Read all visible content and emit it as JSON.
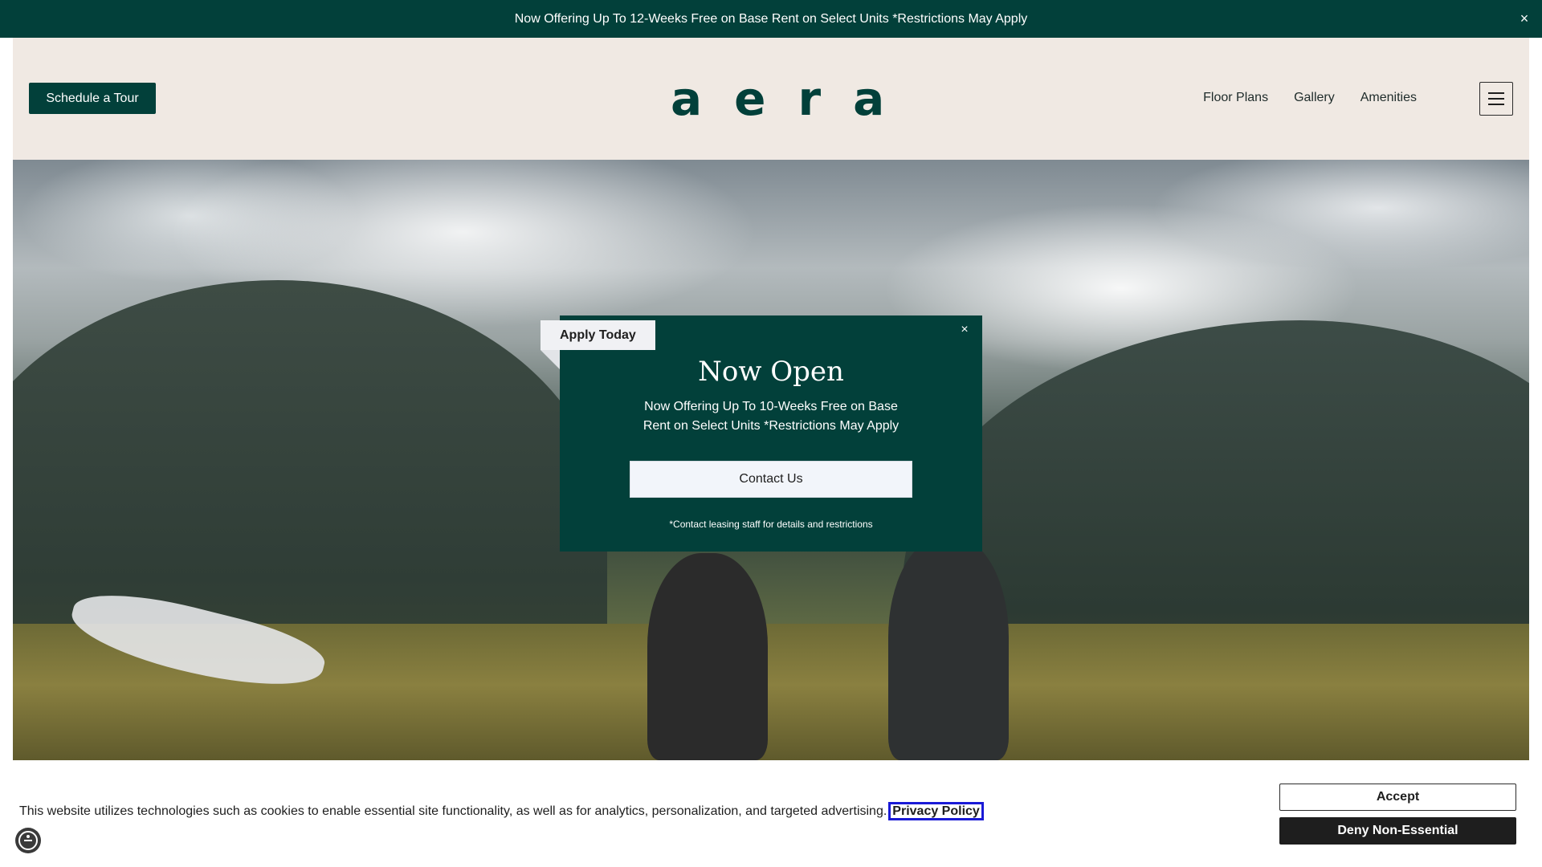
{
  "announcement": {
    "text": "Now Offering Up To 12-Weeks Free on Base Rent on Select Units *Restrictions May Apply",
    "close_label": "×"
  },
  "header": {
    "tour_button": "Schedule a Tour",
    "logo": "aera",
    "nav": [
      "Floor Plans",
      "Gallery",
      "Amenities"
    ]
  },
  "popup": {
    "ribbon": "Apply Today",
    "close_label": "×",
    "title": "Now Open",
    "description": "Now Offering Up To 10-Weeks Free on Base Rent on Select Units *Restrictions May Apply",
    "cta": "Contact Us",
    "note": "*Contact leasing staff for details and restrictions"
  },
  "cookie": {
    "text": "This website utilizes technologies such as cookies to enable essential site functionality, as well as for analytics, personalization, and targeted advertising.",
    "policy_link": "Privacy Policy",
    "accept": "Accept",
    "deny": "Deny Non-Essential"
  },
  "icons": {
    "announcement_close": "close-icon",
    "menu": "hamburger-menu-icon",
    "popup_close": "close-icon",
    "accessibility": "accessibility-icon"
  },
  "colors": {
    "brand_green": "#02403a",
    "header_bg": "#f0e9e3",
    "focus_outline": "#1a1ad6"
  }
}
